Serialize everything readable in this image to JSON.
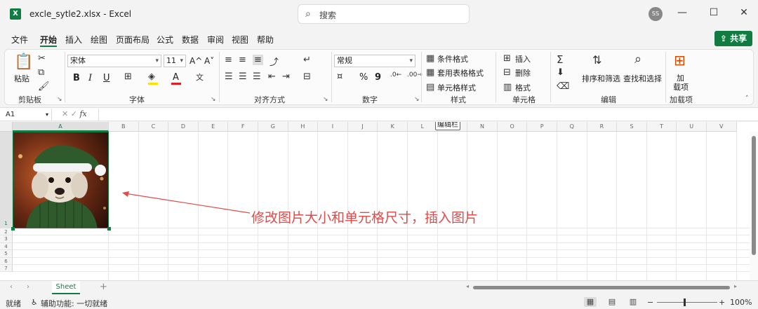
{
  "window": {
    "app_icon_letter": "X",
    "title": "excle_sytle2.xlsx  -  Excel",
    "search_placeholder": "搜索",
    "avatar_initials": "SS",
    "minimize": "—",
    "maximize": "☐",
    "close": "✕"
  },
  "menu": {
    "items": [
      "文件",
      "开始",
      "插入",
      "绘图",
      "页面布局",
      "公式",
      "数据",
      "审阅",
      "视图",
      "帮助"
    ],
    "active": "开始",
    "share": "共享"
  },
  "ribbon": {
    "clipboard": {
      "label": "剪贴板",
      "paste": "粘贴"
    },
    "font": {
      "label": "字体",
      "name": "宋体",
      "size": "11",
      "bold": "B",
      "italic": "I",
      "underline": "U",
      "grow": "A^",
      "shrink": "A˅",
      "color_letter": "A"
    },
    "alignment": {
      "label": "对齐方式"
    },
    "number": {
      "label": "数字",
      "format": "常规",
      "percent": "%",
      "comma": "9"
    },
    "styles": {
      "label": "样式",
      "conditional": "条件格式",
      "table": "套用表格格式",
      "cell_styles": "单元格样式"
    },
    "cells": {
      "label": "单元格",
      "insert": "插入",
      "delete": "删除",
      "format": "格式"
    },
    "editing": {
      "label": "编辑",
      "sort": "排序和筛选",
      "find": "查找和选择"
    },
    "addins": {
      "label": "加载项",
      "button_line1": "加",
      "button_line2": "载项"
    }
  },
  "formula_bar": {
    "name_box": "A1",
    "fx": "fx",
    "value": ""
  },
  "grid": {
    "columns": [
      "A",
      "B",
      "C",
      "D",
      "E",
      "F",
      "G",
      "H",
      "I",
      "J",
      "K",
      "L",
      "M",
      "N",
      "O",
      "P",
      "Q",
      "R",
      "S",
      "T",
      "U",
      "V"
    ],
    "rows": [
      "1",
      "2",
      "3",
      "4",
      "5",
      "6",
      "7"
    ],
    "selected_column": "A",
    "selected_row": "1",
    "tooltip": "编辑栏"
  },
  "annotation": "修改图片大小和单元格尺寸，插入图片",
  "tabs": {
    "sheet_name": "Sheet",
    "add": "+"
  },
  "status": {
    "ready": "就绪",
    "accessibility": "辅助功能: 一切就绪",
    "zoom": "100%"
  },
  "colors": {
    "accent": "#107c41",
    "annotation": "#e34a4a"
  }
}
